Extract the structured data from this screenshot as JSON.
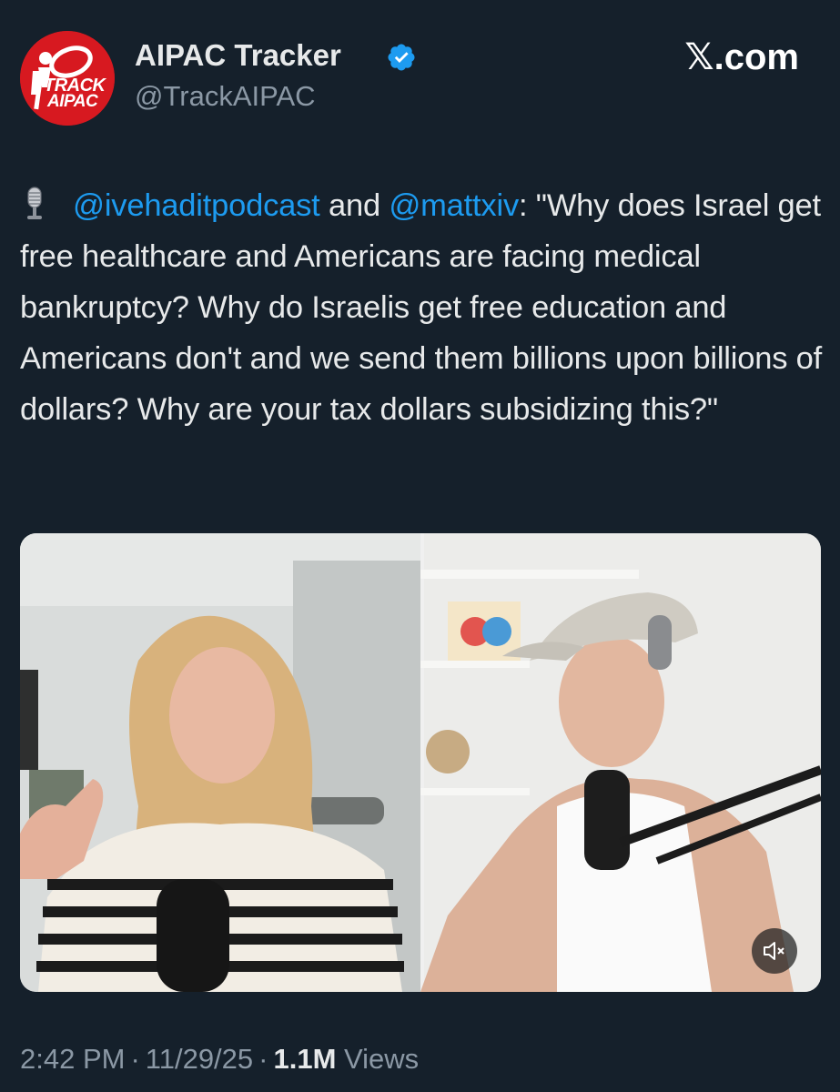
{
  "account": {
    "name": "AIPAC Tracker",
    "handle": "@TrackAIPAC",
    "verified": true,
    "avatar_text_line1": "TRACK",
    "avatar_text_line2": "AIPAC",
    "avatar_color": "#d71920"
  },
  "brand": {
    "site_label": ".com",
    "site_glyph": "𝕏"
  },
  "tweet": {
    "leading_icon": "studio-microphone-icon",
    "mention1": "@ivehaditpodcast",
    "connector": " and ",
    "mention2": "@mattxiv",
    "body": ": \"Why does Israel get free healthcare and Americans are facing medical bankruptcy? Why do Israelis get free education and Americans don't and we send them billions upon billions of dollars? Why are your tax dollars subsidizing this?\""
  },
  "media": {
    "type": "video",
    "mute_icon": "speaker-muted-icon"
  },
  "footer": {
    "time": "2:42 PM",
    "date": "11/29/25",
    "views_count": "1.1M",
    "views_label": "Views",
    "separator": "·"
  },
  "colors": {
    "background": "#15202b",
    "text": "#e7e9ea",
    "secondary": "#8b98a5",
    "link": "#1d9bf0"
  }
}
